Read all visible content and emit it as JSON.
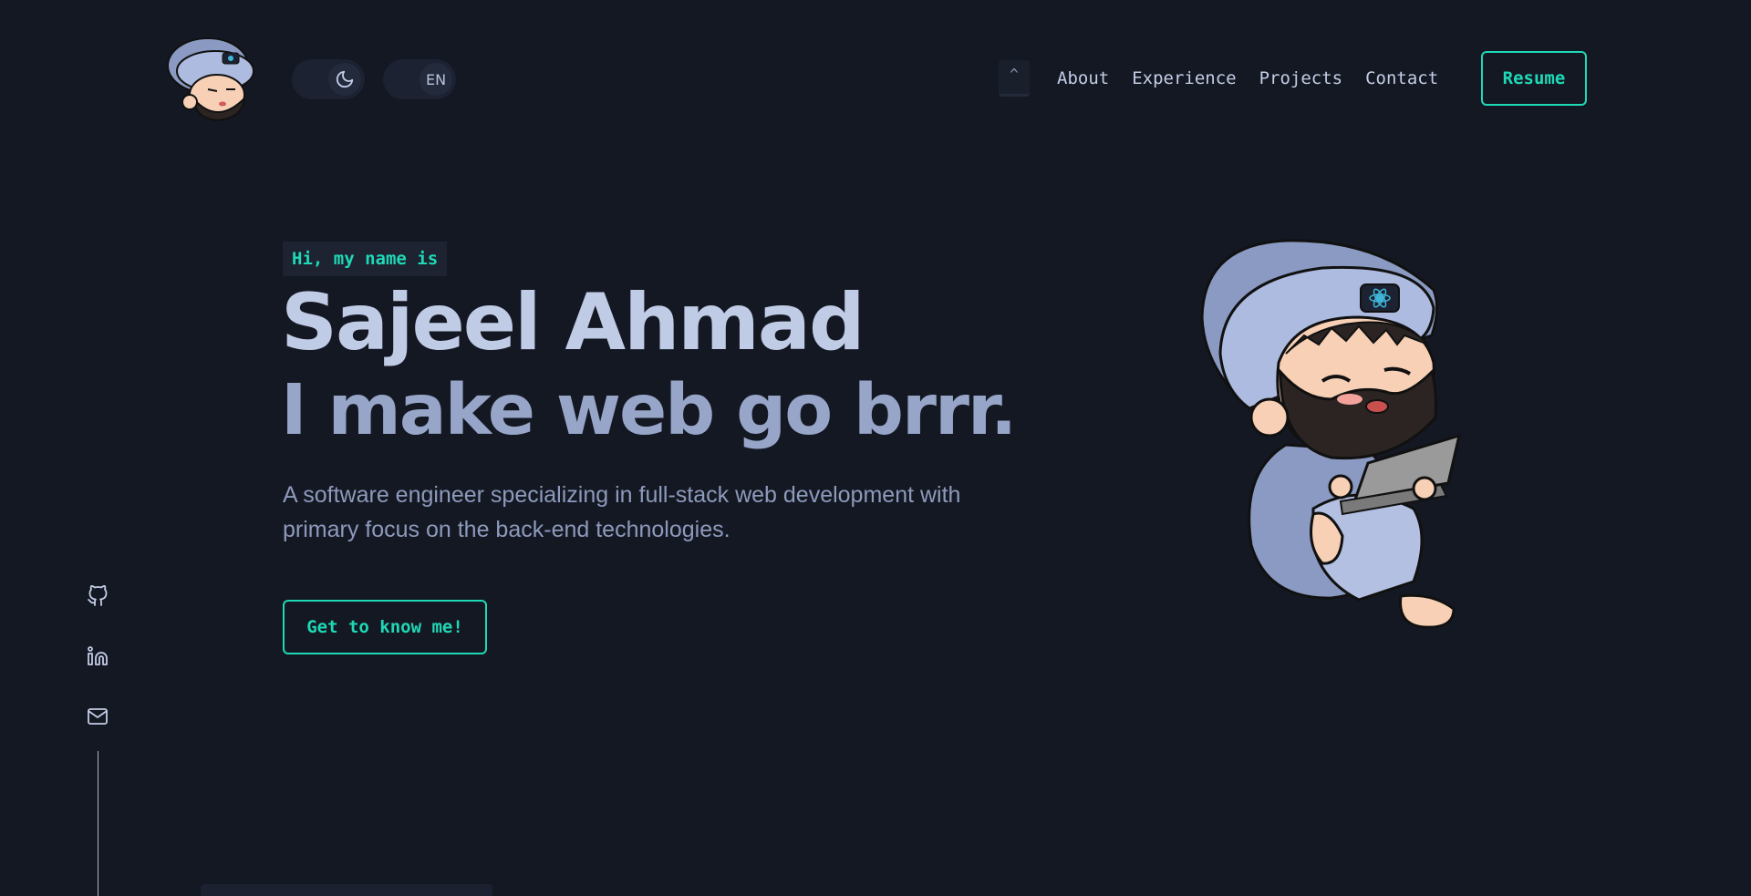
{
  "header": {
    "logo_alt": "avatar-logo",
    "theme_toggle_icon": "moon-icon",
    "lang_toggle_label": "EN",
    "scroll_top_label": "^",
    "nav": [
      {
        "label": "About"
      },
      {
        "label": "Experience"
      },
      {
        "label": "Projects"
      },
      {
        "label": "Contact"
      }
    ],
    "resume_label": "Resume"
  },
  "hero": {
    "greeting": "Hi, my name is",
    "name": "Sajeel Ahmad",
    "tagline": "I make web go brrr.",
    "description": "A software engineer specializing in full-stack web development with primary focus on the back-end technologies.",
    "cta_label": "Get to know me!"
  },
  "social": [
    {
      "icon": "github-icon"
    },
    {
      "icon": "linkedin-icon"
    },
    {
      "icon": "mail-icon"
    }
  ],
  "colors": {
    "background": "#141823",
    "accent": "#1fd8b6",
    "heading": "#c0cbe6",
    "tagline": "#97a5c8",
    "body_text": "#8d9abb"
  }
}
